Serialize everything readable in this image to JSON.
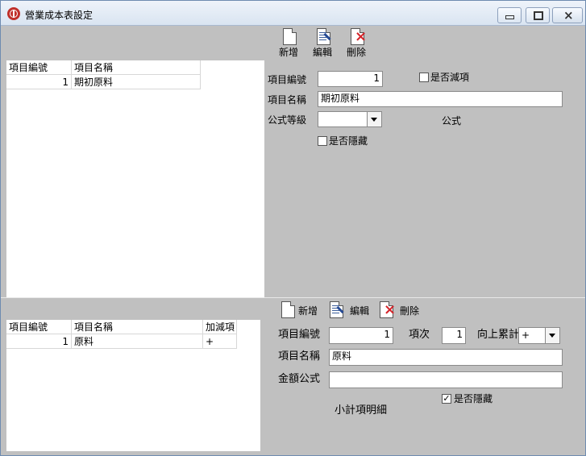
{
  "window": {
    "title": "營業成本表設定"
  },
  "top_toolbar": {
    "new_label": "新增",
    "edit_label": "編輯",
    "delete_label": "刪除"
  },
  "top_grid": {
    "columns": [
      "項目編號",
      "項目名稱"
    ],
    "rows": [
      {
        "code": "1",
        "name": "期初原料"
      }
    ]
  },
  "top_form": {
    "code_label": "項目編號",
    "code_value": "1",
    "subtract_label": "是否減項",
    "subtract_checked": false,
    "name_label": "項目名稱",
    "name_value": "期初原料",
    "formula_level_label": "公式等級",
    "formula_level_value": "",
    "formula_label": "公式",
    "hidden_label": "是否隱藏",
    "hidden_checked": false
  },
  "bottom_toolbar": {
    "new_label": "新增",
    "edit_label": "編輯",
    "delete_label": "刪除"
  },
  "bottom_grid": {
    "columns": [
      "項目編號",
      "項目名稱",
      "加減項"
    ],
    "rows": [
      {
        "code": "1",
        "name": "原料",
        "sign": "+"
      }
    ]
  },
  "bottom_form": {
    "code_label": "項目編號",
    "code_value": "1",
    "seq_label": "項次",
    "seq_value": "1",
    "cumulative_label": "向上累計",
    "cumulative_value": "+",
    "name_label": "項目名稱",
    "name_value": "原料",
    "amount_formula_label": "金額公式",
    "amount_formula_value": "",
    "hidden_label": "是否隱藏",
    "hidden_checked": true,
    "subtotal_detail_label": "小計項明細"
  }
}
